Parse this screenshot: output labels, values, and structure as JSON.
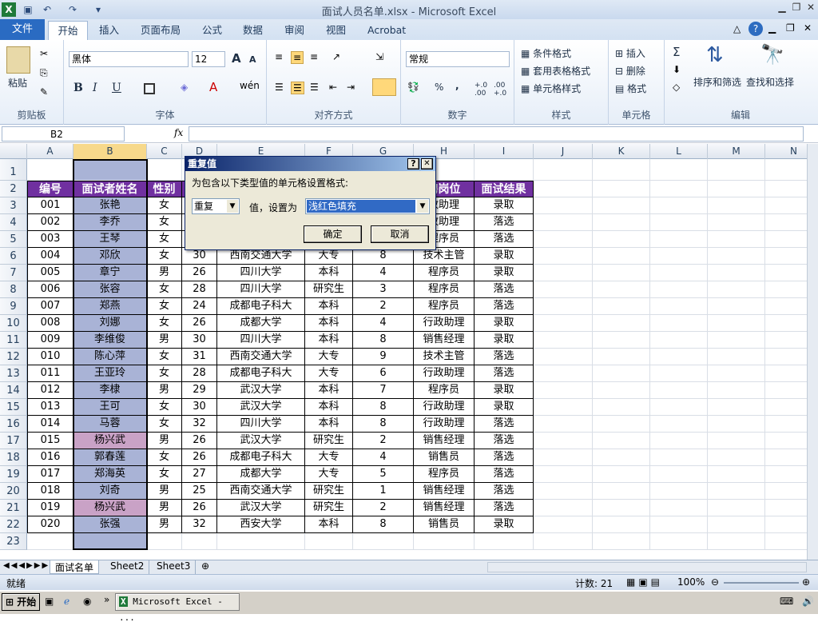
{
  "window": {
    "title": "面试人员名单.xlsx - Microsoft Excel"
  },
  "tabs": [
    "文件",
    "开始",
    "插入",
    "页面布局",
    "公式",
    "数据",
    "审阅",
    "视图",
    "Acrobat"
  ],
  "ribbon": {
    "clipboard": {
      "paste": "粘贴",
      "label": "剪贴板"
    },
    "font": {
      "name": "黑体",
      "size": "12",
      "label": "字体",
      "grow": "A",
      "shrink": "A",
      "bold": "B",
      "italic": "I",
      "underline": "U"
    },
    "align": {
      "label": "对齐方式"
    },
    "number": {
      "format": "常规",
      "percent": "%",
      "comma": ",",
      "label": "数字",
      "inc": "+.0 .00",
      "dec": ".00 +.0"
    },
    "styles": {
      "cond": "条件格式",
      "table": "套用表格格式",
      "cell": "单元格样式",
      "label": "样式"
    },
    "cells": {
      "insert": "插入",
      "delete": "删除",
      "format": "格式",
      "label": "单元格"
    },
    "edit": {
      "sum": "Σ",
      "sort": "排序和筛选",
      "find": "查找和选择",
      "label": "编辑"
    }
  },
  "namebox": "B2",
  "fx": "fx",
  "columns": [
    "A",
    "B",
    "C",
    "D",
    "E",
    "F",
    "G",
    "H",
    "I",
    "J",
    "K",
    "L",
    "M",
    "N"
  ],
  "headers": [
    "编号",
    "面试者姓名",
    "性别",
    "",
    "",
    "",
    "",
    "聘岗位",
    "面试结果"
  ],
  "rows": [
    [
      "001",
      "张艳",
      "女",
      "",
      "",
      "",
      "",
      "政助理",
      "录取"
    ],
    [
      "002",
      "李乔",
      "女",
      "",
      "",
      "",
      "",
      "政助理",
      "落选"
    ],
    [
      "003",
      "王琴",
      "女",
      "",
      "",
      "",
      "",
      "程序员",
      "落选"
    ],
    [
      "004",
      "邓欣",
      "女",
      "30",
      "西南交通大学",
      "大专",
      "8",
      "技术主管",
      "录取"
    ],
    [
      "005",
      "章宁",
      "男",
      "26",
      "四川大学",
      "本科",
      "4",
      "程序员",
      "录取"
    ],
    [
      "006",
      "张容",
      "女",
      "28",
      "四川大学",
      "研究生",
      "3",
      "程序员",
      "落选"
    ],
    [
      "007",
      "郑燕",
      "女",
      "24",
      "成都电子科大",
      "本科",
      "2",
      "程序员",
      "落选"
    ],
    [
      "008",
      "刘娜",
      "女",
      "26",
      "成都大学",
      "本科",
      "4",
      "行政助理",
      "录取"
    ],
    [
      "009",
      "李维俊",
      "男",
      "30",
      "四川大学",
      "本科",
      "8",
      "销售经理",
      "录取"
    ],
    [
      "010",
      "陈心萍",
      "女",
      "31",
      "西南交通大学",
      "大专",
      "9",
      "技术主管",
      "落选"
    ],
    [
      "011",
      "王亚玲",
      "女",
      "28",
      "成都电子科大",
      "大专",
      "6",
      "行政助理",
      "落选"
    ],
    [
      "012",
      "李棣",
      "男",
      "29",
      "武汉大学",
      "本科",
      "7",
      "程序员",
      "录取"
    ],
    [
      "013",
      "王可",
      "女",
      "30",
      "武汉大学",
      "本科",
      "8",
      "行政助理",
      "录取"
    ],
    [
      "014",
      "马蓉",
      "女",
      "32",
      "四川大学",
      "本科",
      "8",
      "行政助理",
      "落选"
    ],
    [
      "015",
      "杨兴武",
      "男",
      "26",
      "武汉大学",
      "研究生",
      "2",
      "销售经理",
      "落选"
    ],
    [
      "016",
      "郭春莲",
      "女",
      "26",
      "成都电子科大",
      "大专",
      "4",
      "销售员",
      "落选"
    ],
    [
      "017",
      "郑海英",
      "女",
      "27",
      "成都大学",
      "大专",
      "5",
      "程序员",
      "落选"
    ],
    [
      "018",
      "刘奇",
      "男",
      "25",
      "西南交通大学",
      "研究生",
      "1",
      "销售经理",
      "落选"
    ],
    [
      "019",
      "杨兴武",
      "男",
      "26",
      "武汉大学",
      "研究生",
      "2",
      "销售经理",
      "落选"
    ],
    [
      "020",
      "张强",
      "男",
      "32",
      "西安大学",
      "本科",
      "8",
      "销售员",
      "录取"
    ]
  ],
  "duplicate_rows": [
    15,
    19
  ],
  "dialog": {
    "title": "重复值",
    "prompt": "为包含以下类型值的单元格设置格式:",
    "type": "重复",
    "mid": "值，设置为",
    "format": "浅红色填充",
    "ok": "确定",
    "cancel": "取消",
    "help": "?",
    "close": "✕"
  },
  "sheet_tabs": [
    "面试名单",
    "Sheet2",
    "Sheet3"
  ],
  "status": {
    "ready": "就绪",
    "count": "计数: 21",
    "zoom": "100%"
  },
  "taskbar": {
    "start": "开始",
    "app": "Microsoft Excel - ..."
  },
  "colors": {
    "header_purple": "#7030a0",
    "selection": "#a9b3d6",
    "duplicate": "#c9a2c6",
    "border": "#000000"
  }
}
